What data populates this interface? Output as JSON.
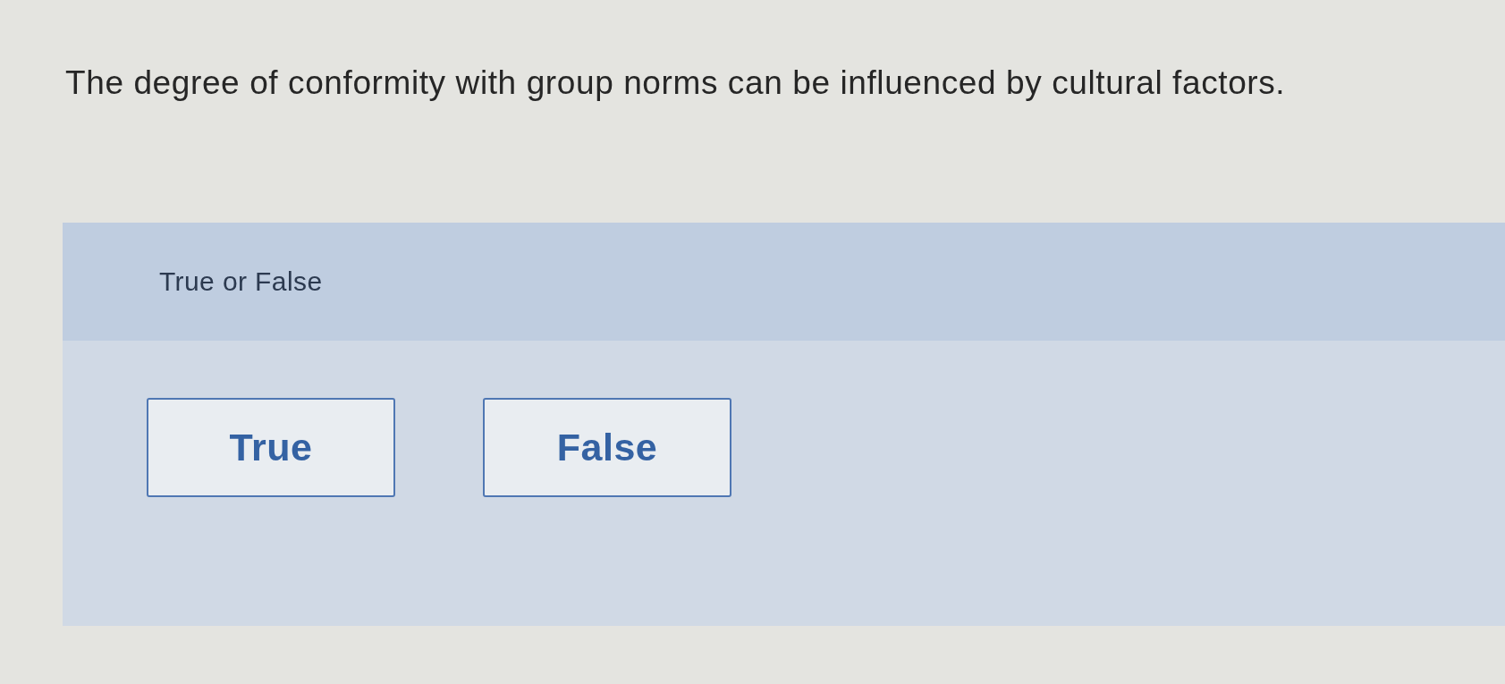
{
  "question": {
    "text": "The degree of conformity with group norms can be influenced by cultural factors."
  },
  "answer_panel": {
    "label": "True or False",
    "options": [
      {
        "label": "True",
        "selected": false
      },
      {
        "label": "False",
        "selected": false
      }
    ]
  }
}
